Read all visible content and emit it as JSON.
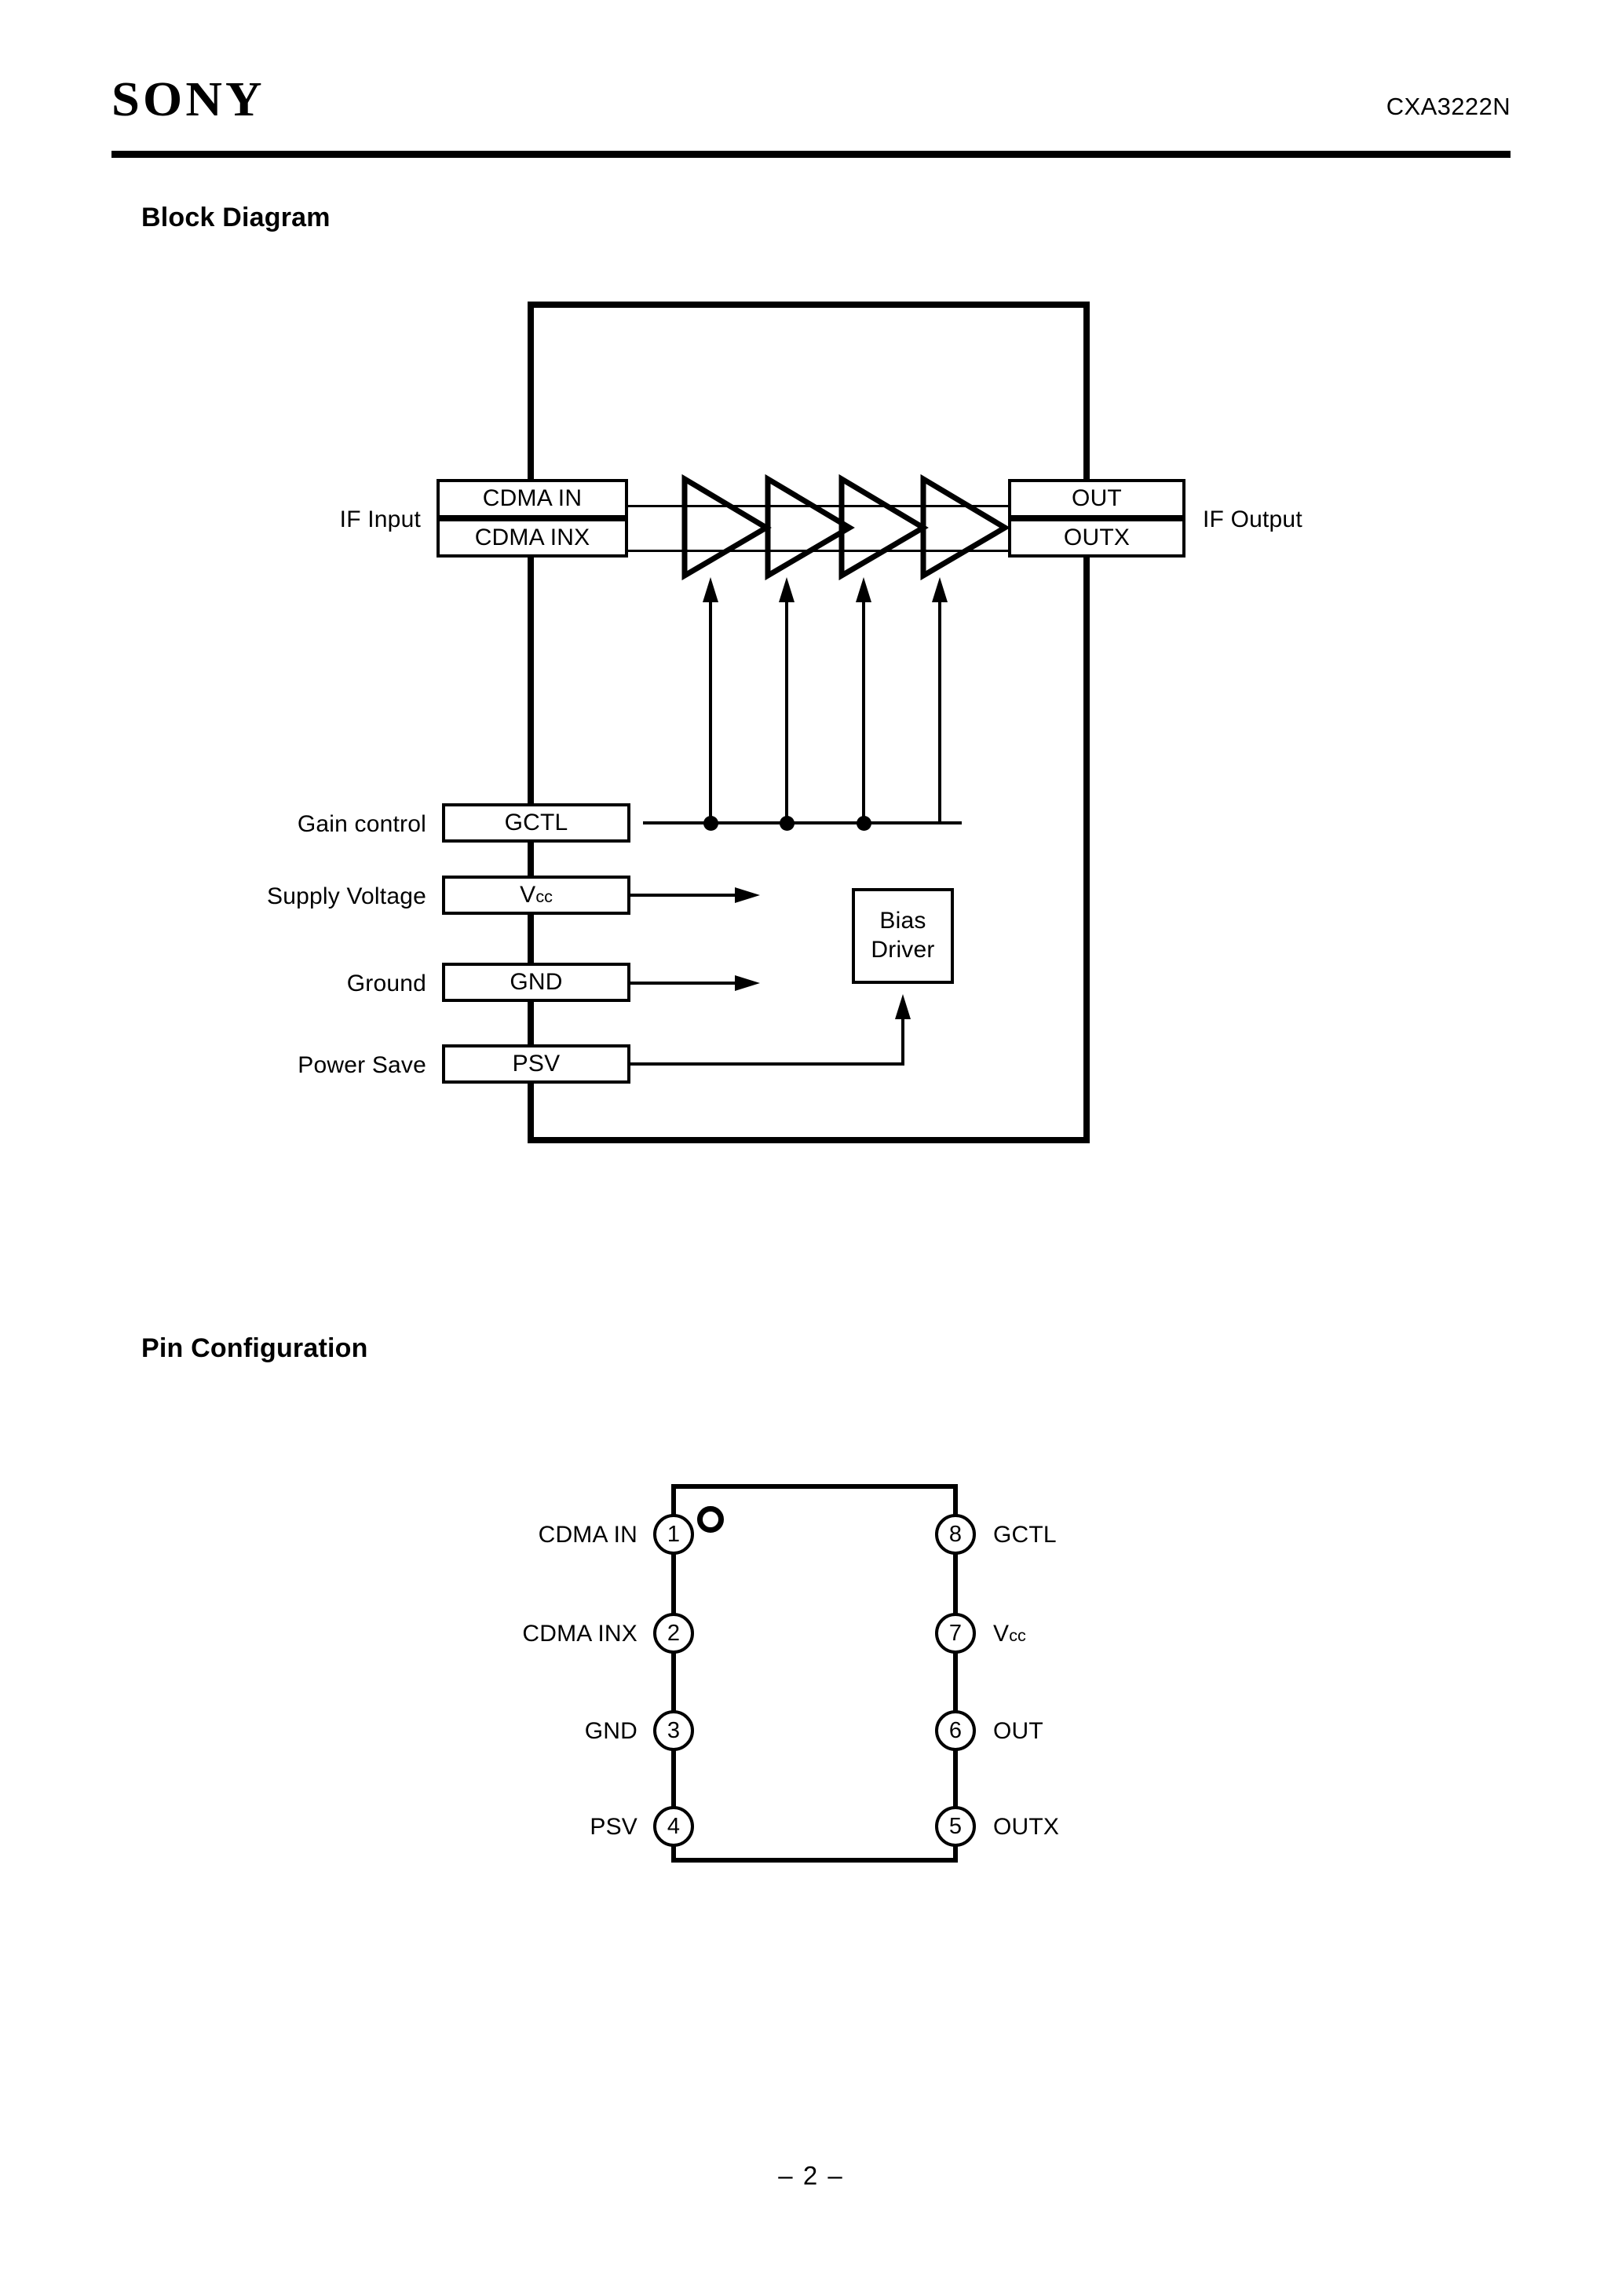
{
  "header": {
    "logo": "SONY",
    "part_number": "CXA3222N"
  },
  "sections": {
    "block_diagram": {
      "heading": "Block Diagram"
    },
    "pin_configuration": {
      "heading": "Pin Configuration"
    }
  },
  "block_diagram": {
    "external_labels": {
      "if_input": "IF Input",
      "if_output": "IF Output",
      "gain_control": "Gain control",
      "supply_voltage": "Supply Voltage",
      "ground": "Ground",
      "power_save": "Power Save"
    },
    "pin_blocks": {
      "cdma_in": "CDMA IN",
      "cdma_inx": "CDMA INX",
      "out": "OUT",
      "outx": "OUTX",
      "gctl": "GCTL",
      "vcc_main": "V",
      "vcc_sub": "cc",
      "gnd": "GND",
      "psv": "PSV"
    },
    "internal_blocks": {
      "bias_driver_line1": "Bias",
      "bias_driver_line2": "Driver"
    },
    "amplifier_count": 4,
    "gain_control_taps": 4
  },
  "pin_configuration": {
    "package_pin_count": 8,
    "pin1_marker": "pin1-index-circle",
    "left_pins": [
      {
        "number": "1",
        "name": "CDMA IN"
      },
      {
        "number": "2",
        "name": "CDMA INX"
      },
      {
        "number": "3",
        "name": "GND"
      },
      {
        "number": "4",
        "name": "PSV"
      }
    ],
    "right_pins": [
      {
        "number": "8",
        "name": "GCTL"
      },
      {
        "number": "7",
        "name": "V",
        "name_sub": "cc"
      },
      {
        "number": "6",
        "name": "OUT"
      },
      {
        "number": "5",
        "name": "OUTX"
      }
    ]
  },
  "footer": {
    "page_marker": "– 2 –"
  },
  "colors": {
    "ink": "#000000",
    "paper": "#ffffff"
  }
}
